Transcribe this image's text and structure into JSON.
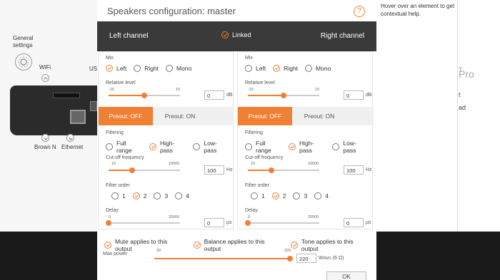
{
  "background": {
    "left": {
      "general_settings": "General\nsettings",
      "wifi": "WiFi",
      "usb_cut": "US",
      "brown_cut": "Brown N",
      "ethernet": "Ethernet"
    },
    "right": {
      "help_text": "Hover over an element to get contextual help.",
      "pro_small": "T",
      "pro_large": "Pro",
      "text1": "t",
      "text2": "ad"
    }
  },
  "dialog": {
    "title": "Speakers configuration: master",
    "help_icon": "?",
    "left_channel": "Left channel",
    "right_channel": "Right channel",
    "linked": "Linked",
    "labels": {
      "mix": "Mix",
      "relative_level": "Relative level",
      "filtering": "Filtering",
      "cutoff": "Cut-off frequency",
      "filter_order": "Filter order",
      "delay": "Delay"
    },
    "mix_options": [
      "Left",
      "Right",
      "Mono"
    ],
    "filter_options": [
      "Full range",
      "High-pass",
      "Low-pass"
    ],
    "order_options": [
      "1",
      "2",
      "3",
      "4"
    ],
    "preout_off": "Preout: OFF",
    "preout_on": "Preout: ON",
    "level_min": "-15",
    "level_max": "15",
    "level_unit": "dB",
    "cutoff_min": "10",
    "cutoff_max": "10000",
    "cutoff_unit": "Hz",
    "delay_min": "0",
    "delay_max": "20000",
    "delay_unit": "µs",
    "left": {
      "mix_selected": "Left",
      "level_value": "0",
      "level_fraction": 0.5,
      "filter_selected": "High-pass",
      "cutoff_value": "100",
      "cutoff_fraction": 0.33,
      "order_selected": "2",
      "delay_value": "0",
      "delay_fraction": 0
    },
    "right": {
      "mix_selected": "Right",
      "level_value": "0",
      "level_fraction": 0.5,
      "filter_selected": "High-pass",
      "cutoff_value": "100",
      "cutoff_fraction": 0.33,
      "order_selected": "2",
      "delay_value": "0",
      "delay_fraction": 0
    },
    "footer": {
      "mute": "Mute applies to this output",
      "balance": "Balance applies to this output",
      "tone": "Tone applies to this output",
      "max_power_label": "Max power",
      "power_min": "30",
      "power_max": "220",
      "power_value": "220",
      "power_fraction": 1.0,
      "power_unit_main": "W",
      "power_unit_sub": "RMS",
      "power_unit_tail": " (6 Ω)",
      "ok": "OK"
    }
  }
}
